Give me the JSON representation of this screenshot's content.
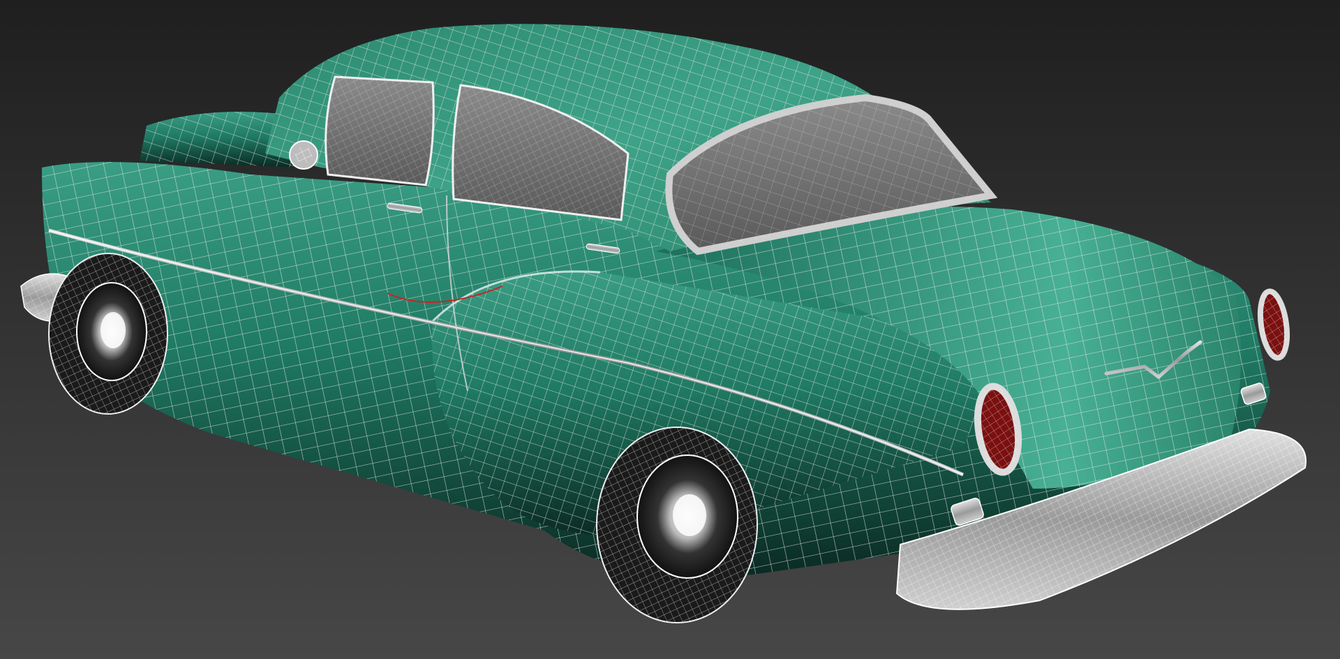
{
  "viewport": {
    "view": "perspective",
    "shading": "wireframe-on-shaded"
  },
  "model": {
    "body_color": "#1f7a63",
    "body_highlight": "#3a9e84",
    "body_shadow": "#0a2a22",
    "wire_color": "#f2f2f2",
    "glass_color": "#7a7a7a",
    "chrome_color": "#c8c8c8",
    "taillight_color": "#7a1010",
    "selection_color": "#cc2222"
  },
  "colors": {
    "background_top": "#1f1f1f",
    "background_bottom": "#474747"
  }
}
